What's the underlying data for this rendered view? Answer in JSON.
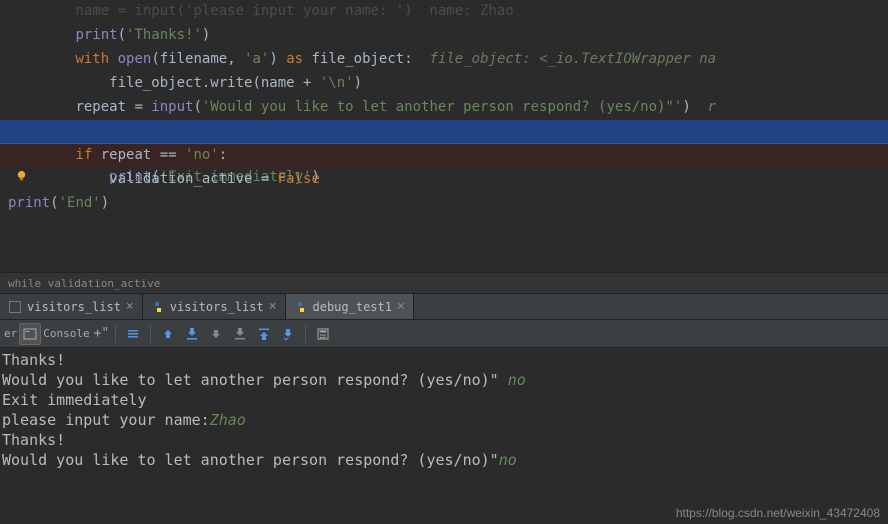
{
  "code": {
    "l0": "        name = input('please input your name: ')  name: Zhao",
    "l1_pre": "        ",
    "l1_fn": "print",
    "l1_str": "'Thanks!'",
    "l2_pre": "        ",
    "l2_kw_with": "with",
    "l2_fn_open": "open",
    "l2_arg1": "filename",
    "l2_arg2": "'a'",
    "l2_kw_as": "as",
    "l2_var": "file_object:",
    "l2_comment": "  file_object: <_io.TextIOWrapper na",
    "l3_pre": "            ",
    "l3_obj": "file_object.write(name + ",
    "l3_str": "'\\n'",
    "l4_pre": "        ",
    "l4_var": "repeat = ",
    "l4_fn": "input",
    "l4_str": "'Would you like to let another person respond? (yes/no)\"'",
    "l4_comment": "  r",
    "l5_pre": "        ",
    "l5_fn": "print",
    "l5_str": "'Exit immediately'",
    "l6_pre": "        ",
    "l6_kw": "if",
    "l6_cond": " repeat == ",
    "l6_str": "'no'",
    "l7_pre": "            ",
    "l7_var": "validation_active = ",
    "l7_const": "False",
    "l8_fn": "print",
    "l8_str": "'End'"
  },
  "breadcrumb": "while validation_active",
  "tabs": {
    "t1": "visitors_list",
    "t2": "visitors_list",
    "t3": "debug_test1"
  },
  "toolbar": {
    "left_label": "er",
    "console_label": "Console"
  },
  "console": {
    "l1": "Thanks!",
    "l2a": "Would you like to let another person respond? (yes/no)\" ",
    "l2b": "no",
    "l3": "Exit immediately",
    "l4a": "please input your name:",
    "l4b": "Zhao",
    "l5": "Thanks!",
    "l6a": "Would you like to let another person respond? (yes/no)\"",
    "l6b": "no"
  },
  "watermark": "https://blog.csdn.net/weixin_43472408"
}
